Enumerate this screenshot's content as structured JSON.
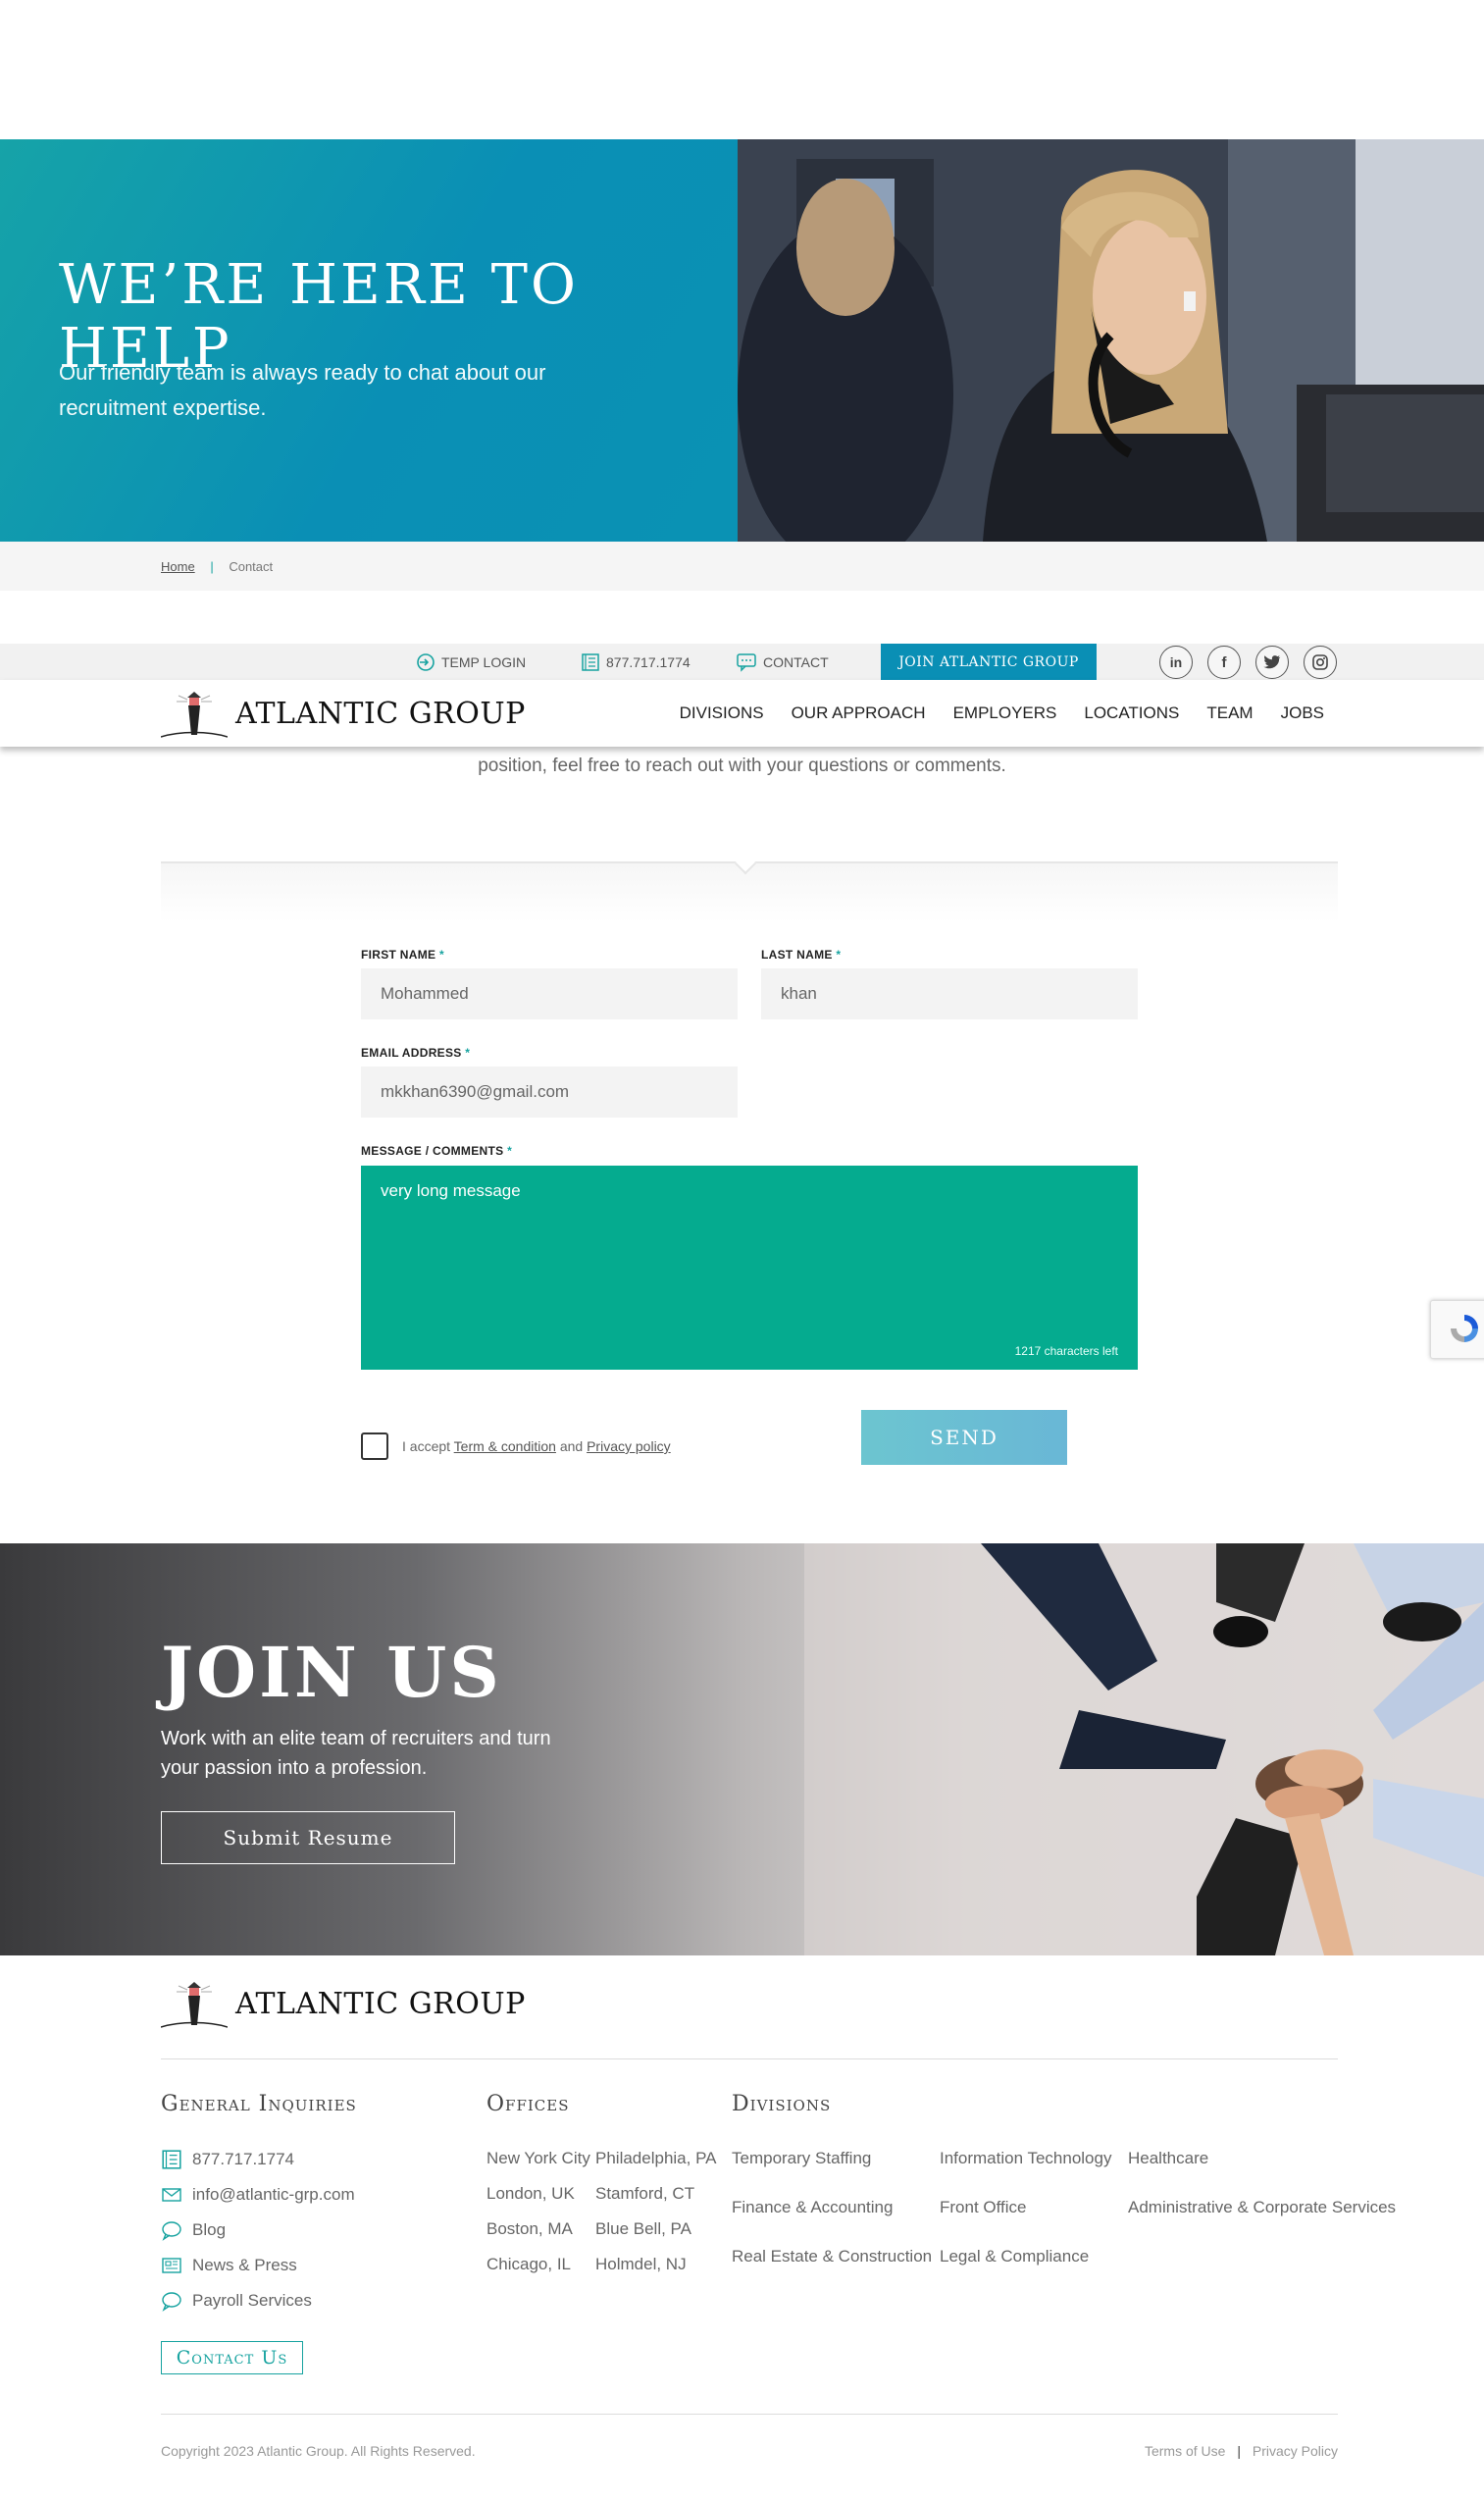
{
  "hero": {
    "title": "WE’RE HERE TO HELP",
    "subtitle": "Our friendly team is always ready to chat about our recruitment expertise."
  },
  "breadcrumb": {
    "home": "Home",
    "separator": "|",
    "current": "Contact"
  },
  "utility": {
    "temp_login": "TEMP LOGIN",
    "phone": "877.717.1774",
    "contact": "CONTACT",
    "join": "JOIN ATLANTIC GROUP",
    "social": [
      "in",
      "f",
      "twitter",
      "instagram"
    ]
  },
  "nav": {
    "logo_text": "ATLANTIC GROUP",
    "links": [
      "DIVISIONS",
      "OUR APPROACH",
      "EMPLOYERS",
      "LOCATIONS",
      "TEAM",
      "JOBS"
    ]
  },
  "intro_text": "position, feel free to reach out with your questions or comments.",
  "form": {
    "first_name_label": "FIRST NAME",
    "last_name_label": "LAST NAME",
    "email_label": "EMAIL ADDRESS",
    "message_label": "MESSAGE / COMMENTS",
    "required_mark": "*",
    "first_name_value": "Mohammed",
    "last_name_value": "khan",
    "email_value": "mkkhan6390@gmail.com",
    "message_value": "very long message",
    "chars_left": "1217 characters left",
    "accept_prefix": "I accept",
    "terms_link": "Term & condition",
    "and": "and",
    "privacy_link": "Privacy policy",
    "send_label": "SEND"
  },
  "join": {
    "title": "JOIN US",
    "subtitle": "Work with an elite team of recruiters and turn your passion into a profession.",
    "button": "Submit Resume"
  },
  "footer": {
    "logo_text": "ATLANTIC GROUP",
    "general_heading": "General Inquiries",
    "general": {
      "phone": "877.717.1774",
      "email": "info@atlantic-grp.com",
      "blog": "Blog",
      "news": "News & Press",
      "payroll": "Payroll Services"
    },
    "contact_button": "Contact Us",
    "offices_heading": "Offices",
    "offices_col1": [
      "New York City",
      "London, UK",
      "Boston, MA",
      "Chicago, IL"
    ],
    "offices_col2": [
      "Philadelphia, PA",
      "Stamford, CT",
      "Blue Bell, PA",
      "Holmdel, NJ"
    ],
    "divisions_heading": "Divisions",
    "divisions_col1": [
      "Temporary Staffing",
      "Finance & Accounting",
      "Real Estate & Construction"
    ],
    "divisions_col2": [
      "Information Technology",
      "Front Office",
      "Legal & Compliance"
    ],
    "divisions_col3": [
      "Healthcare",
      "Administrative & Corporate Services"
    ],
    "copyright": "Copyright 2023 Atlantic Group. All Rights Reserved.",
    "terms": "Terms of Use",
    "legal_sep": "|",
    "privacy": "Privacy Policy"
  },
  "colors": {
    "teal": "#17a3a0",
    "blue": "#0a8fb5",
    "message_bg": "#05ab8f"
  }
}
